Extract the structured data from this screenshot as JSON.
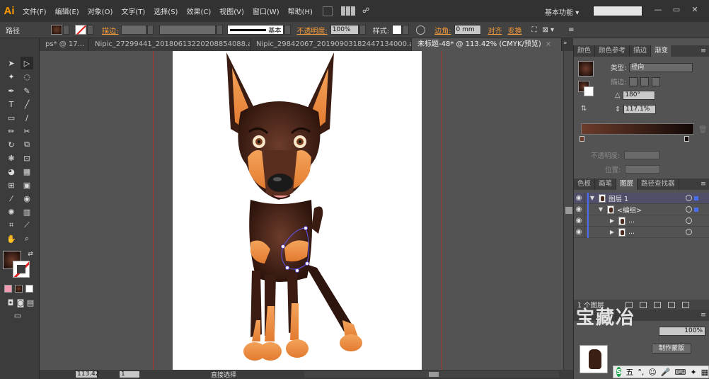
{
  "app": {
    "logo": "Ai",
    "menu": [
      "文件(F)",
      "编辑(E)",
      "对象(O)",
      "文字(T)",
      "选择(S)",
      "效果(C)",
      "视图(V)",
      "窗口(W)",
      "帮助(H)"
    ],
    "workspace_label": "基本功能",
    "workspace_caret": "▾",
    "window_buttons": [
      "—",
      "▭",
      "✕"
    ]
  },
  "control_bar": {
    "object_type": "路径",
    "stroke_label": "描边:",
    "stroke_profile": "基本",
    "opacity_label": "不透明度:",
    "opacity_value": "100%",
    "style_label": "样式:",
    "corner_label": "边角:",
    "corner_value": "0 mm",
    "align_label": "对齐",
    "transform_label": "变换"
  },
  "tabs": [
    {
      "label": "ps* @ 17...",
      "active": false
    },
    {
      "label": "Nipic_27299441_20180613220208854088.ai*",
      "active": false
    },
    {
      "label": "Nipic_29842067_20190903182447134000.ai*",
      "active": false
    },
    {
      "label": "未标题-48* @ 113.42% (CMYK/预览)",
      "active": true
    }
  ],
  "tab_close": "×",
  "tab_overflow": "»",
  "status": {
    "zoom": "113.42",
    "page": "1",
    "tool": "直接选择"
  },
  "gradient_panel": {
    "tabs": [
      "颜色",
      "颜色参考",
      "描边",
      "渐变"
    ],
    "type_label": "类型:",
    "type_value": "径向",
    "stroke_label": "描边:",
    "angle_value": "180°",
    "aspect_value": "117.1%",
    "opacity_label": "不透明度:",
    "location_label": "位置:",
    "start_color": "#6d3c2b",
    "end_color": "#120806"
  },
  "layers_panel": {
    "tabs": [
      "色板",
      "画笔",
      "图层",
      "路径查找器"
    ],
    "rows": [
      {
        "name": "图层 1",
        "indent": 0
      },
      {
        "name": "<编组>",
        "indent": 1
      },
      {
        "name": "...",
        "indent": 2
      },
      {
        "name": "...",
        "indent": 2
      }
    ],
    "footer": "1 个图层"
  },
  "transparency_panel": {
    "opacity": "100%",
    "mask_button": "制作蒙版"
  },
  "watermark": "宝藏冶",
  "ime": {
    "logo": "S",
    "mode": "五"
  },
  "colors": {
    "accent_orange": "#f39a3a",
    "layer_color": "#4a6cf0",
    "selection": "#5a4cd0",
    "dog_dark": "#3d1f16",
    "dog_tan": "#f0934a"
  }
}
